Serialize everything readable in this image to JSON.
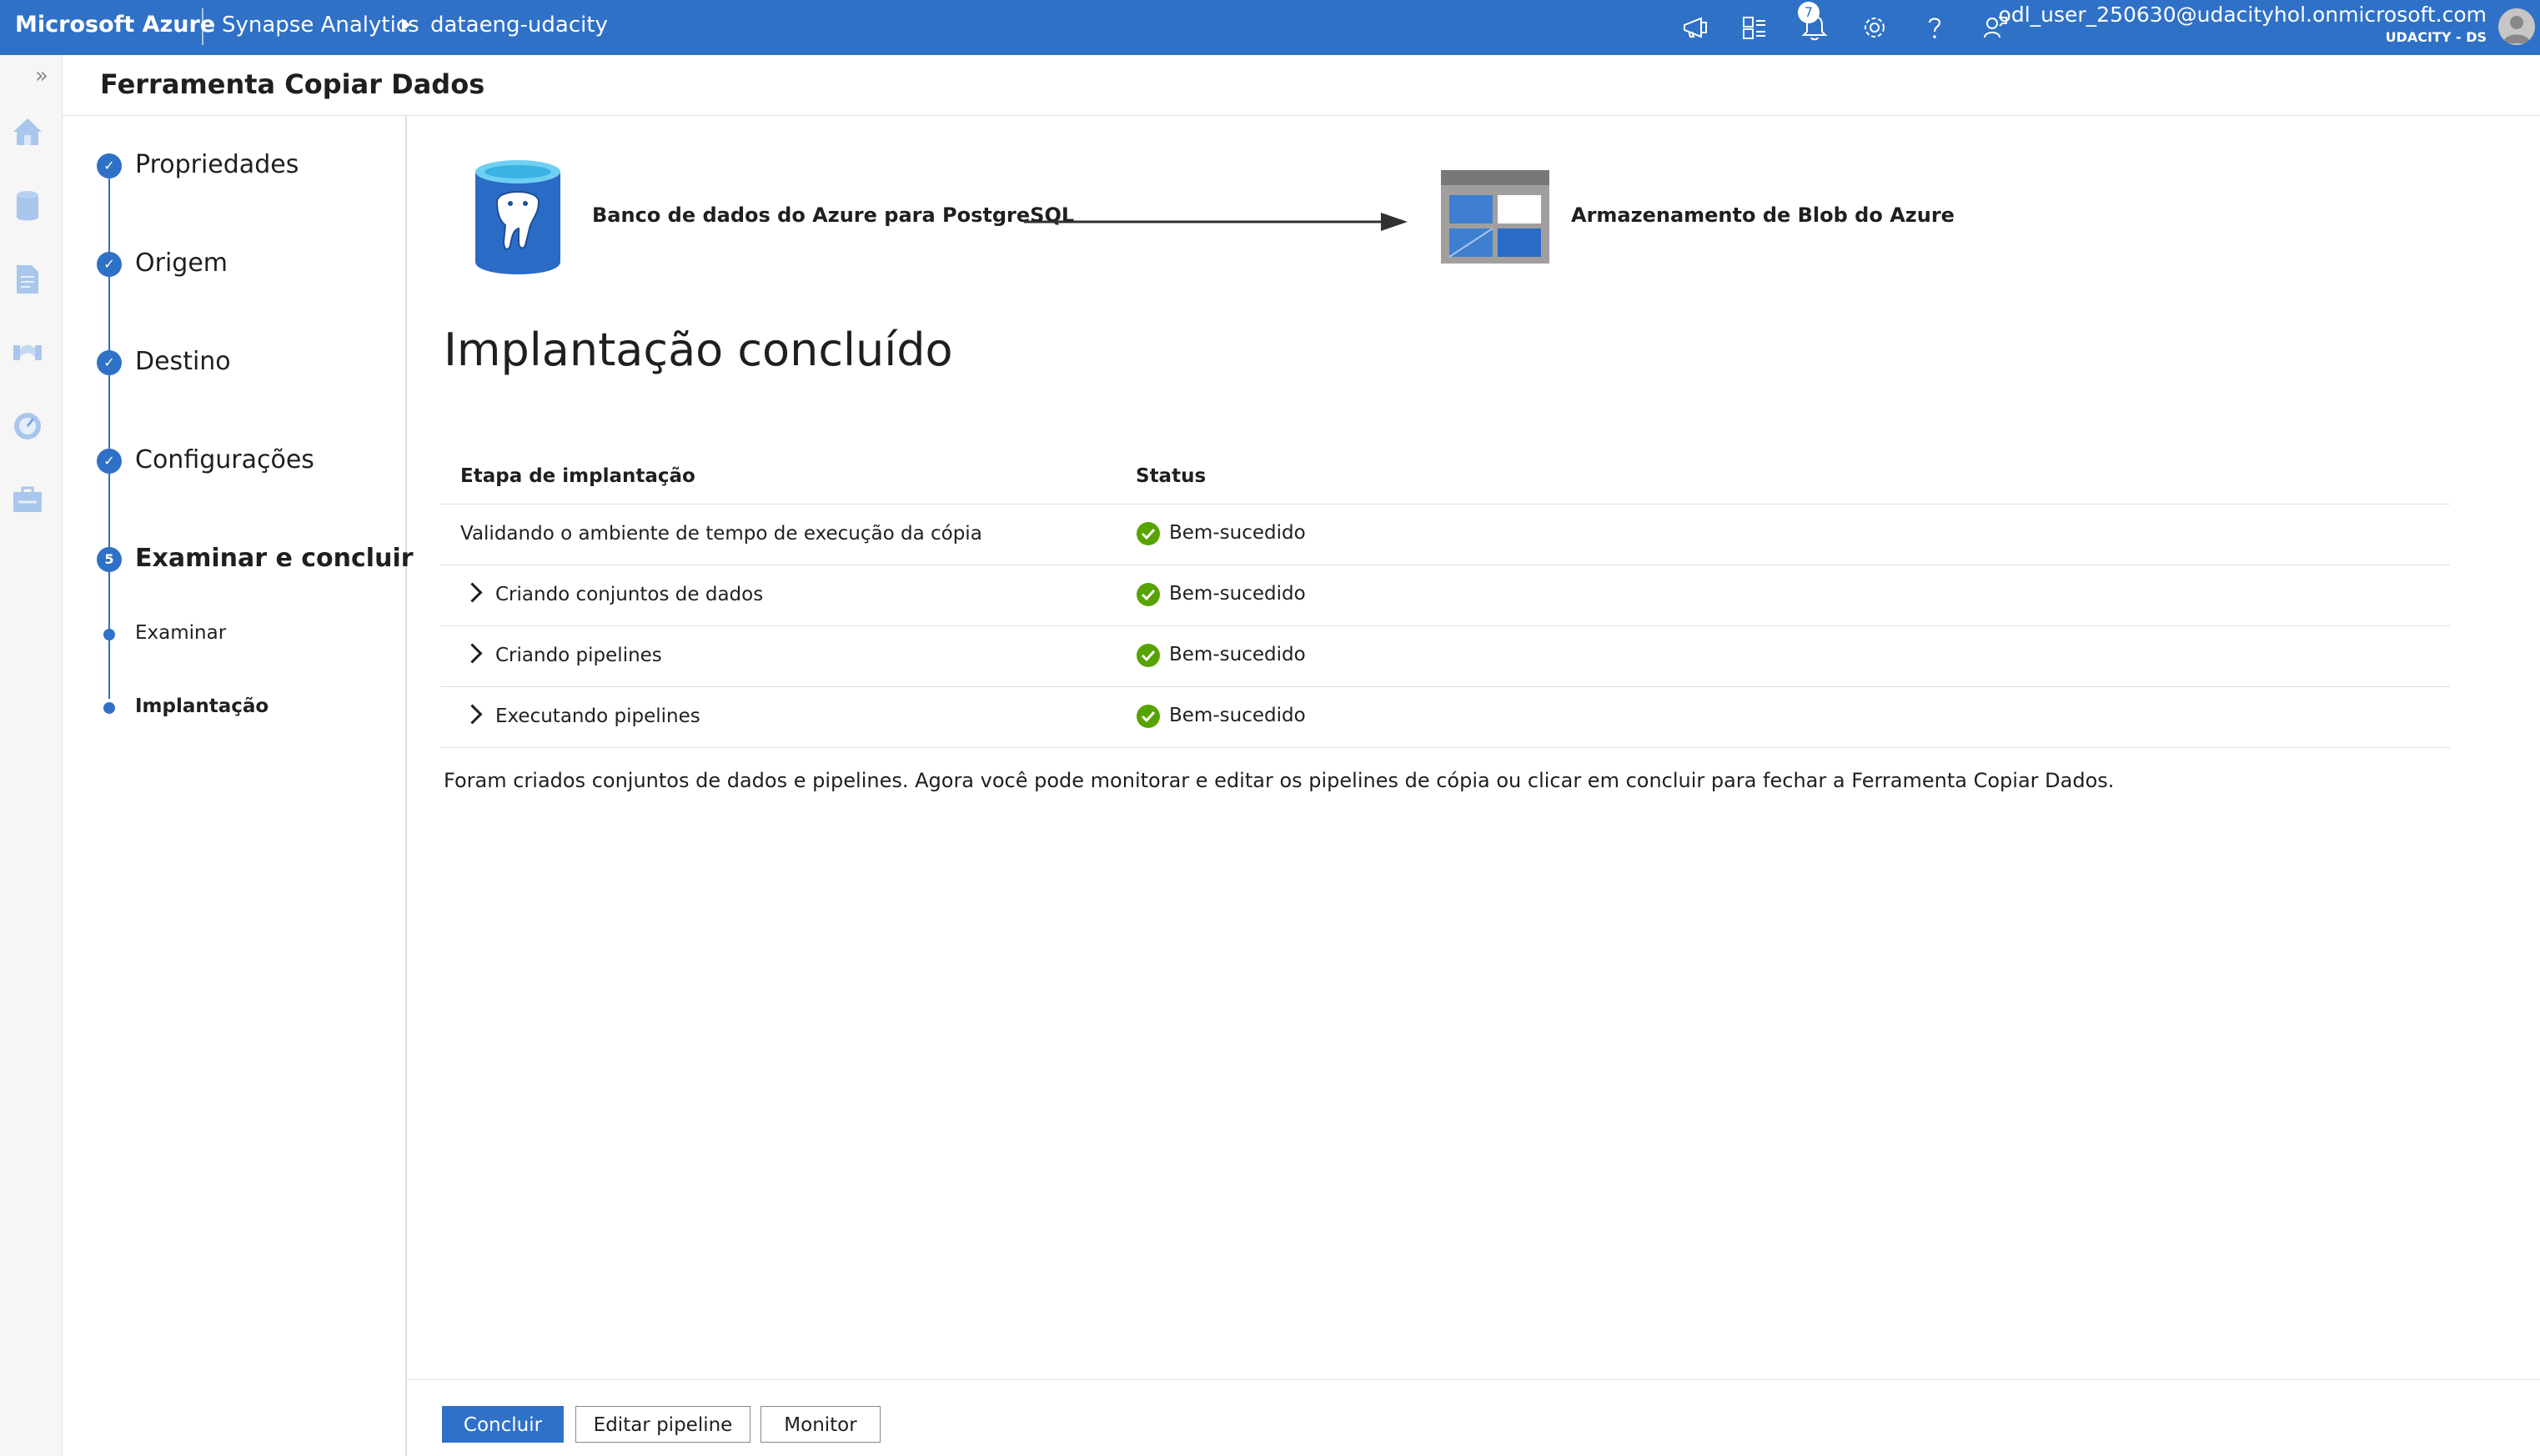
{
  "topbar": {
    "brand": "Microsoft Azure",
    "breadcrumb": [
      "Synapse Analytics",
      "dataeng-udacity"
    ],
    "notifications_count": "7",
    "user_email": "odl_user_250630@udacityhol.onmicrosoft.com",
    "user_org": "UDACITY - DS",
    "icons": [
      "feedback-icon",
      "directory-icon",
      "notifications-icon",
      "settings-icon",
      "help-icon",
      "cloud-shell-icon"
    ]
  },
  "rail": {
    "icons": [
      "home-icon",
      "data-icon",
      "develop-icon",
      "integrate-icon",
      "monitor-icon",
      "manage-icon"
    ]
  },
  "page": {
    "title": "Ferramenta Copiar Dados"
  },
  "steps": {
    "items": [
      {
        "label": "Propriedades",
        "marker": "✓"
      },
      {
        "label": "Origem",
        "marker": "✓"
      },
      {
        "label": "Destino",
        "marker": "✓"
      },
      {
        "label": "Configurações",
        "marker": "✓"
      },
      {
        "label": "Examinar e concluir",
        "marker": "5"
      }
    ],
    "substeps": [
      {
        "label": "Examinar"
      },
      {
        "label": "Implantação"
      }
    ]
  },
  "flow": {
    "source_label": "Banco de dados do Azure para PostgreSQL",
    "destination_label": "Armazenamento de Blob do Azure"
  },
  "main": {
    "heading": "Implantação concluído",
    "table": {
      "headers": [
        "Etapa de implantação",
        "Status"
      ],
      "rows": [
        {
          "step": "Validando o ambiente de tempo de execução da cópia",
          "status": "Bem-sucedido"
        },
        {
          "step": "Criando conjuntos de dados",
          "status": "Bem-sucedido"
        },
        {
          "step": "Criando pipelines",
          "status": "Bem-sucedido"
        },
        {
          "step": "Executando pipelines",
          "status": "Bem-sucedido"
        }
      ]
    },
    "message": "Foram criados conjuntos de dados e pipelines. Agora você pode monitorar e editar os pipelines de cópia ou clicar em concluir para fechar a Ferramenta Copiar Dados."
  },
  "footer": {
    "finish_label": "Concluir",
    "edit_pipeline_label": "Editar pipeline",
    "monitor_label": "Monitor"
  },
  "colors": {
    "accent": "#2f71c7",
    "success": "#57a300"
  }
}
